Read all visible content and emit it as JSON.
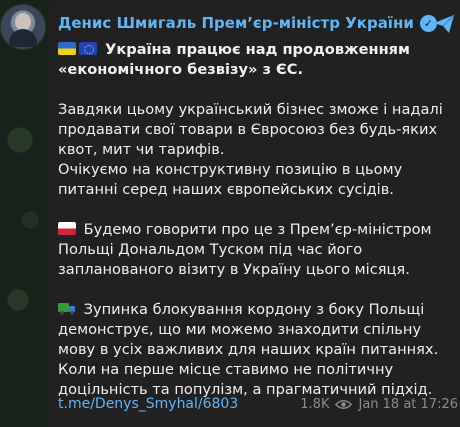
{
  "channel": {
    "name": "Денис Шмигаль Прем’єр-міністр України"
  },
  "post": {
    "headline": "Україна працює над продовженням «економічного безвізу» з ЄС.",
    "paragraph1": "Завдяки цьому український бізнес зможе і надалі продавати свої товари в Євросоюз без будь-яких квот, мит чи тарифів.",
    "paragraph2": "Очікуємо на конструктивну позицію в цьому питанні серед наших європейських сусідів.",
    "paragraph3": "Будемо говорити про це з Прем’єр-міністром Польщі Дональдом Туском під час його запланованого візиту в Україну цього місяця.",
    "paragraph4": "Зупинка блокування кордону з боку Польщі демонструє, що ми можемо знаходити спільну мову в усіх важливих для наших країн питаннях. Коли на перше місце ставимо не політичну доцільність та популізм, а прагматичний підхід.",
    "link": "t.me/Denys_Smyhal/6803",
    "views": "1.8K",
    "timestamp": "Jan 18 at 17:26"
  },
  "icons": {
    "verified": "verified-badge-icon",
    "share": "share-icon",
    "views": "eye-icon",
    "flags": [
      "ukraine-flag",
      "eu-flag",
      "poland-flag"
    ],
    "truck": "truck-icon"
  },
  "colors": {
    "accent": "#5eb5f7",
    "bubble": "#212121",
    "meta": "#8c8c8c"
  }
}
